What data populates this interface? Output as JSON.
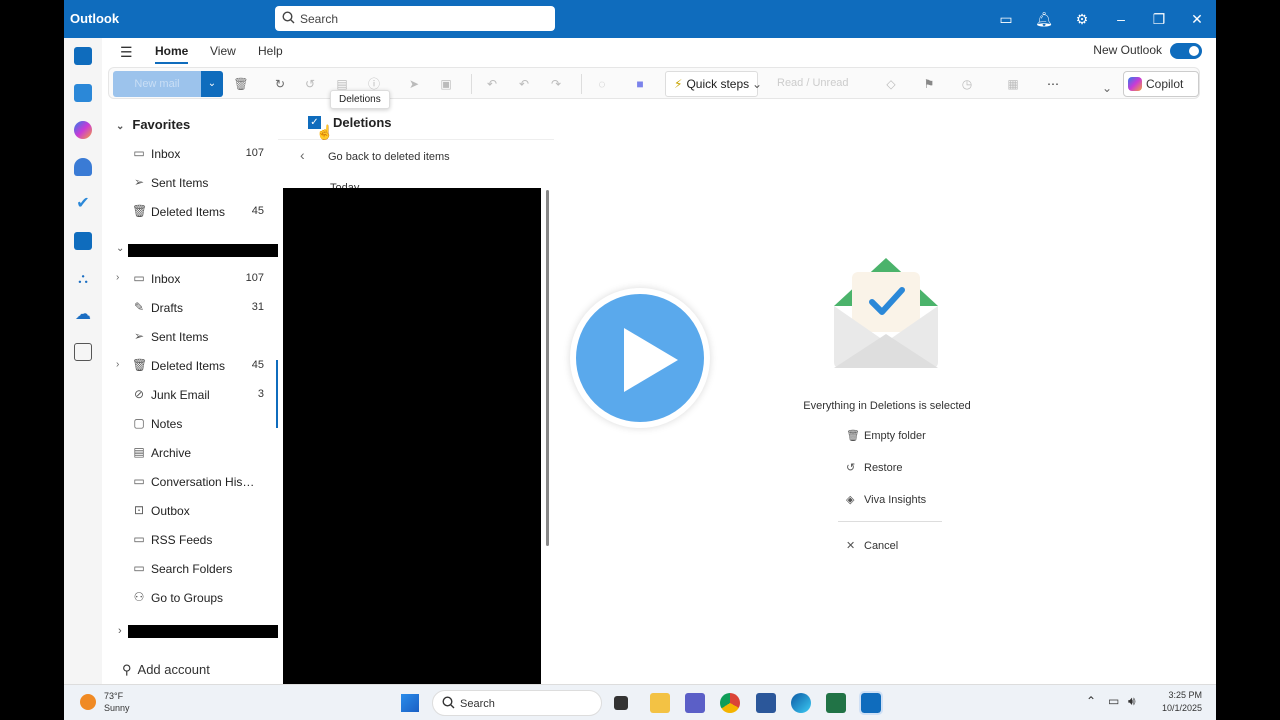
{
  "titlebar": {
    "app_title": "Outlook",
    "search_placeholder": "Search"
  },
  "menu": {
    "tabs": [
      "Home",
      "View",
      "Help"
    ],
    "new_outlook_label": "New Outlook"
  },
  "ribbon": {
    "new_email_label": "New mail",
    "quick_steps_label": "Quick steps",
    "read_unread_label": "Read / Unread",
    "copilot_label": "Copilot"
  },
  "tooltip": "Deletions",
  "favorites": {
    "header": "Favorites",
    "items": [
      {
        "label": "Inbox",
        "count": "107"
      },
      {
        "label": "Sent Items",
        "count": ""
      },
      {
        "label": "Deleted Items",
        "count": "45"
      }
    ]
  },
  "account_folders": [
    {
      "label": "Inbox",
      "count": "107"
    },
    {
      "label": "Drafts",
      "count": "31"
    },
    {
      "label": "Sent Items",
      "count": ""
    },
    {
      "label": "Deleted Items",
      "count": "45"
    },
    {
      "label": "Junk Email",
      "count": "3"
    },
    {
      "label": "Notes",
      "count": ""
    },
    {
      "label": "Archive",
      "count": ""
    },
    {
      "label": "Conversation History",
      "count": ""
    },
    {
      "label": "Outbox",
      "count": ""
    },
    {
      "label": "RSS Feeds",
      "count": ""
    },
    {
      "label": "Search Folders",
      "count": ""
    },
    {
      "label": "Go to Groups",
      "count": ""
    }
  ],
  "add_account_label": "Add account",
  "message_list": {
    "folder_title": "Deletions",
    "back_label": "Go back to deleted items",
    "group_today": "Today"
  },
  "reading_pane": {
    "selection_text": "Everything in Deletions is selected",
    "actions": {
      "empty_folder": "Empty folder",
      "restore": "Restore",
      "viva_insights": "Viva Insights",
      "cancel": "Cancel"
    }
  },
  "taskbar": {
    "weather_temp": "73°F",
    "weather_desc": "Sunny",
    "search_placeholder": "Search",
    "time": "3:25 PM",
    "date": "10/1/2025"
  },
  "colors": {
    "brand": "#0f6cbd",
    "play_button": "#5aa9ec"
  }
}
